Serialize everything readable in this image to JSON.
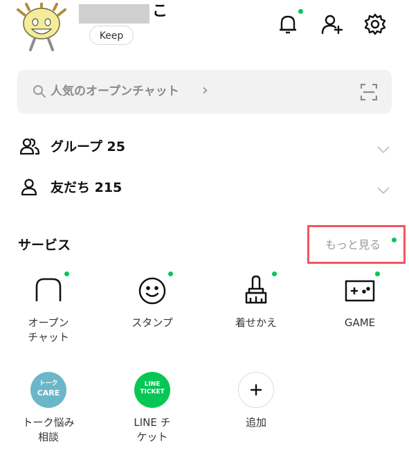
{
  "header": {
    "name_suffix": "こ",
    "keep_label": "Keep",
    "icons": [
      "bell-icon",
      "add-friend-icon",
      "gear-icon"
    ]
  },
  "search": {
    "placeholder": "人気のオープンチャット",
    "chevron": "›",
    "icons": [
      "search-icon",
      "scan-icon"
    ]
  },
  "lists": [
    {
      "label": "グループ 25",
      "icon": "group-icon"
    },
    {
      "label": "友だち 215",
      "icon": "person-icon"
    }
  ],
  "services": {
    "title": "サービス",
    "more_label": "もっと見る",
    "items": [
      {
        "label_line1": "オープン",
        "label_line2": "チャット",
        "icon": "openchat-icon",
        "has_dot": true
      },
      {
        "label_line1": "スタンプ",
        "label_line2": "",
        "icon": "smiley-icon",
        "has_dot": true
      },
      {
        "label_line1": "着せかえ",
        "label_line2": "",
        "icon": "brush-icon",
        "has_dot": true
      },
      {
        "label_line1": "GAME",
        "label_line2": "",
        "icon": "game-controller-icon",
        "has_dot": true
      },
      {
        "label_line1": "トーク悩み",
        "label_line2": "相談",
        "icon": "talk-care-icon",
        "badge_line1": "トーク",
        "badge_line2": "CARE",
        "badge_color": "#6cb6c9"
      },
      {
        "label_line1": "LINE チ",
        "label_line2": "ケット",
        "icon": "line-ticket-icon",
        "badge_line1": "LINE",
        "badge_line2": "TICKET",
        "badge_color": "#06c755"
      },
      {
        "label_line1": "追加",
        "label_line2": "",
        "icon": "plus-icon"
      }
    ]
  },
  "colors": {
    "accent_dot": "#06c755",
    "highlight_border": "#f2545f"
  }
}
